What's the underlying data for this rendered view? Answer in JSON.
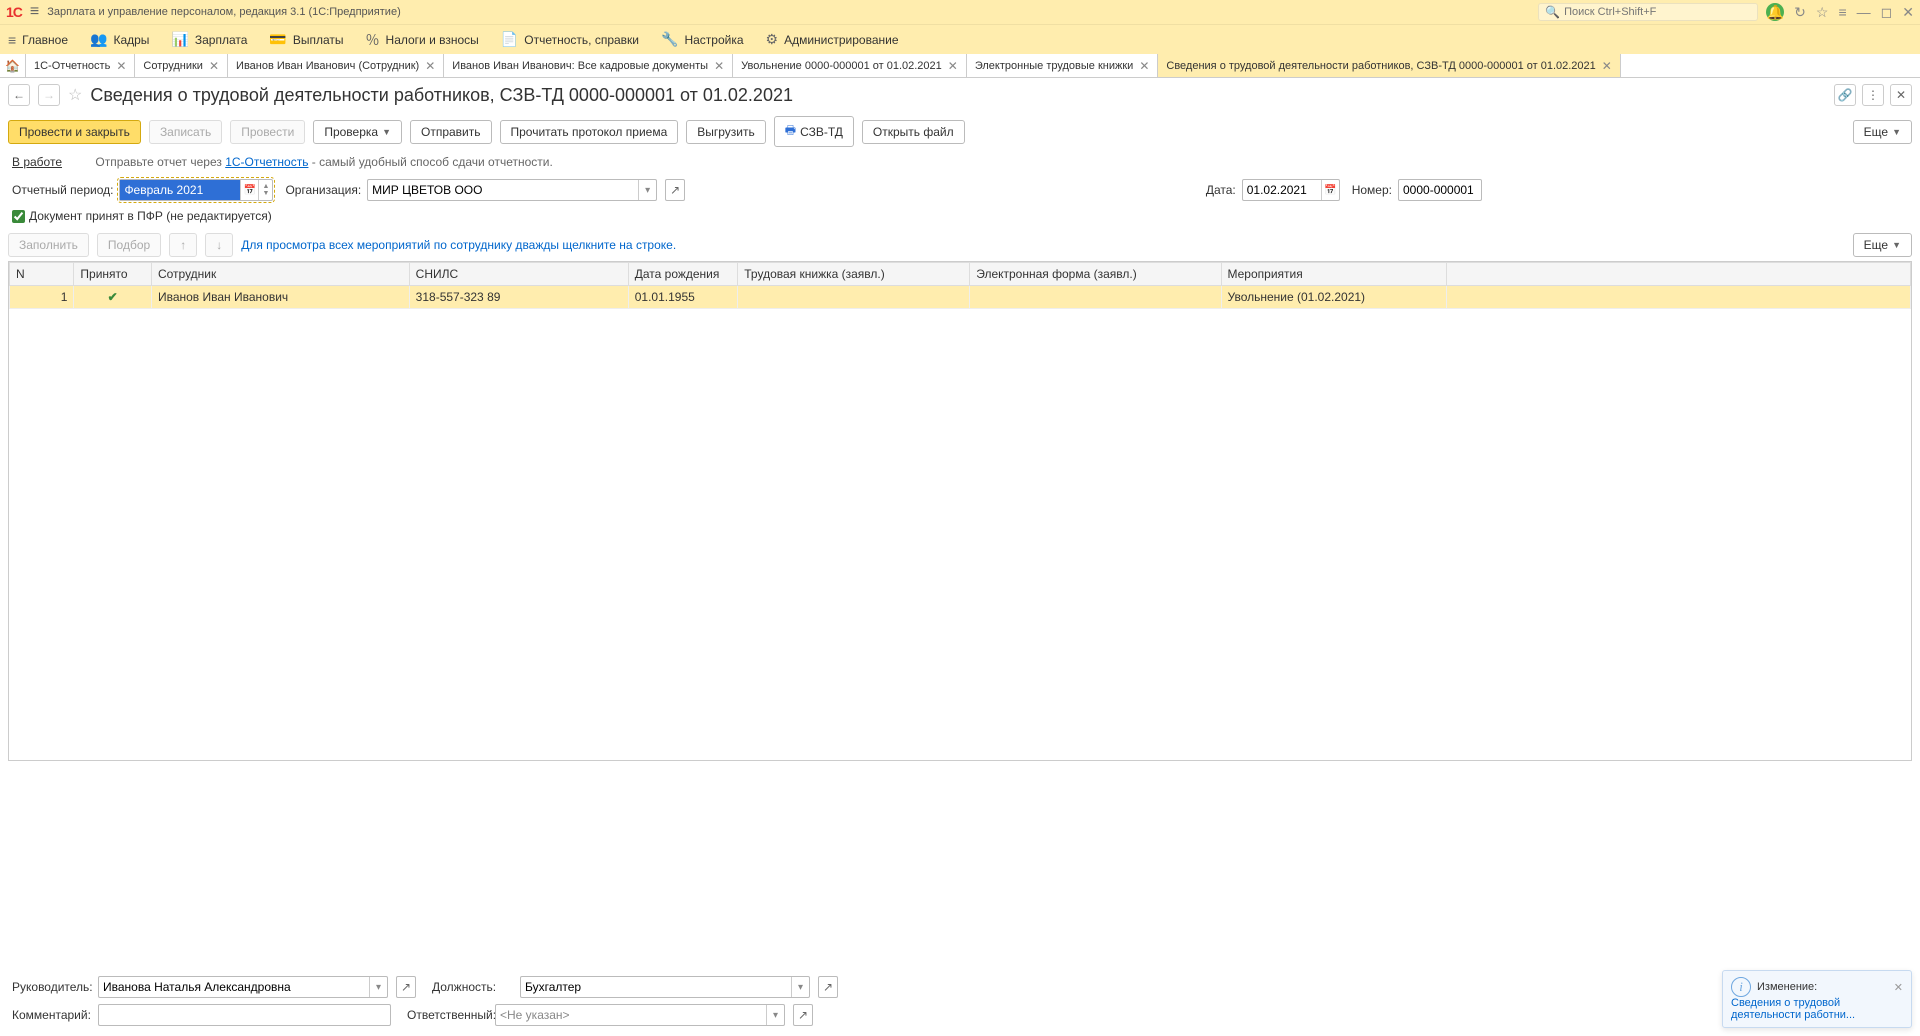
{
  "app": {
    "title": "Зарплата и управление персоналом, редакция 3.1  (1С:Предприятие)",
    "search_placeholder": "Поиск Ctrl+Shift+F"
  },
  "mainmenu": [
    {
      "icon": "≡",
      "label": "Главное"
    },
    {
      "icon": "👥",
      "label": "Кадры"
    },
    {
      "icon": "📊",
      "label": "Зарплата"
    },
    {
      "icon": "💳",
      "label": "Выплаты"
    },
    {
      "icon": "％",
      "label": "Налоги и взносы"
    },
    {
      "icon": "📄",
      "label": "Отчетность, справки"
    },
    {
      "icon": "🔧",
      "label": "Настройка"
    },
    {
      "icon": "⚙",
      "label": "Администрирование"
    }
  ],
  "tabs": [
    {
      "label": "1С-Отчетность"
    },
    {
      "label": "Сотрудники"
    },
    {
      "label": "Иванов Иван Иванович (Сотрудник)"
    },
    {
      "label": "Иванов Иван Иванович: Все кадровые документы"
    },
    {
      "label": "Увольнение 0000-000001 от 01.02.2021"
    },
    {
      "label": "Электронные трудовые книжки"
    },
    {
      "label": "Сведения о трудовой деятельности работников, СЗВ-ТД 0000-000001 от 01.02.2021",
      "active": true
    }
  ],
  "page": {
    "title": "Сведения о трудовой деятельности работников, СЗВ-ТД 0000-000001 от 01.02.2021"
  },
  "toolbar": {
    "post_close": "Провести и закрыть",
    "save": "Записать",
    "post": "Провести",
    "check": "Проверка",
    "send": "Отправить",
    "read_protocol": "Прочитать протокол приема",
    "export": "Выгрузить",
    "szvtd": "СЗВ-ТД",
    "open_file": "Открыть файл",
    "more": "Еще"
  },
  "info": {
    "status": "В работе",
    "pre": "Отправьте отчет через ",
    "link": "1С-Отчетность",
    "post": " - самый удобный способ сдачи отчетности."
  },
  "form": {
    "period_label": "Отчетный период:",
    "period_value": "Февраль 2021",
    "org_label": "Организация:",
    "org_value": "МИР ЦВЕТОВ ООО",
    "date_label": "Дата:",
    "date_value": "01.02.2021",
    "number_label": "Номер:",
    "number_value": "0000-000001",
    "accepted_label": "Документ принят в ПФР (не редактируется)"
  },
  "tbl_toolbar": {
    "fill": "Заполнить",
    "pick": "Подбор",
    "hint": "Для просмотра всех мероприятий по сотруднику дважды щелкните на строке.",
    "more": "Еще"
  },
  "table": {
    "headers": [
      "N",
      "Принято",
      "Сотрудник",
      "СНИЛС",
      "Дата рождения",
      "Трудовая книжка (заявл.)",
      "Электронная форма (заявл.)",
      "Мероприятия",
      ""
    ],
    "rows": [
      {
        "n": "1",
        "accepted": true,
        "emp": "Иванов Иван Иванович",
        "snils": "318-557-323 89",
        "dob": "01.01.1955",
        "tk": "",
        "ef": "",
        "ev": "Увольнение (01.02.2021)"
      }
    ]
  },
  "footer": {
    "head_label": "Руководитель:",
    "head_value": "Иванова Наталья Александровна",
    "pos_label": "Должность:",
    "pos_value": "Бухгалтер",
    "comment_label": "Комментарий:",
    "comment_value": "",
    "resp_label": "Ответственный:",
    "resp_value": "<Не указан>"
  },
  "notif": {
    "title": "Изменение:",
    "link": "Сведения о трудовой деятельности работни..."
  }
}
